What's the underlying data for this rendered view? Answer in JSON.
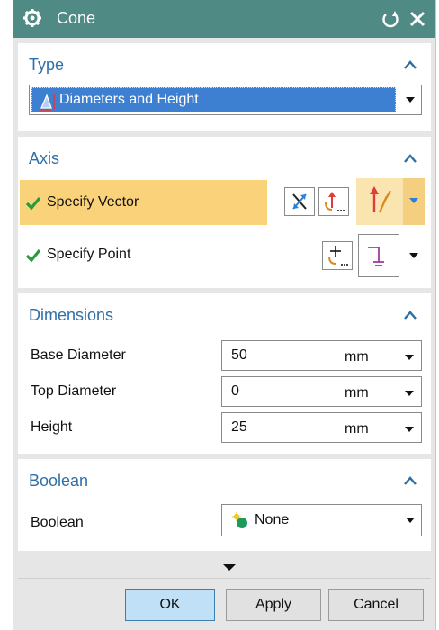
{
  "window": {
    "title": "Cone",
    "titlebar_color": "#4f8a84",
    "icons": {
      "app": "gear-icon",
      "reset": "reset-icon",
      "close": "close-icon"
    }
  },
  "type_group": {
    "header": "Type",
    "selected": "Diameters and Height",
    "selected_icon": "cone-diameters-height-icon"
  },
  "axis_group": {
    "header": "Axis",
    "specify_vector": "Specify Vector",
    "specify_point": "Specify Point",
    "highlight_color": "#f9d27a"
  },
  "dimensions_group": {
    "header": "Dimensions",
    "rows": [
      {
        "label": "Base Diameter",
        "value": "50",
        "unit": "mm"
      },
      {
        "label": "Top Diameter",
        "value": "0",
        "unit": "mm"
      },
      {
        "label": "Height",
        "value": "25",
        "unit": "mm"
      }
    ]
  },
  "boolean_group": {
    "header": "Boolean",
    "label": "Boolean",
    "selected": "None"
  },
  "buttons": {
    "ok": "OK",
    "apply": "Apply",
    "cancel": "Cancel"
  },
  "colors": {
    "header_text": "#2e6fa8",
    "selection": "#3d7fd0",
    "ok_button": "#bfe0f7"
  }
}
